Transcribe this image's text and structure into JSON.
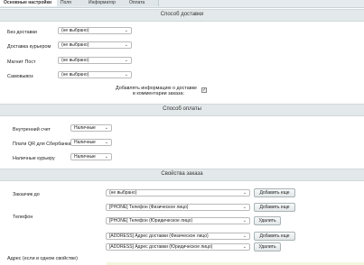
{
  "tabs": [
    "Основные настройки",
    "Поля",
    "Информатор",
    "Оплата"
  ],
  "delivery": {
    "title": "Способ доставки",
    "rows": [
      {
        "label": "Без доставки",
        "value": "(не выбрано)"
      },
      {
        "label": "Доставка курьером",
        "value": "(не выбрано)"
      },
      {
        "label": "Магнит Пост",
        "value": "(не выбрано)"
      },
      {
        "label": "Самовывоз",
        "value": "(не выбрано)"
      }
    ],
    "add_info_line1": "Добавлять информацию о доставке",
    "add_info_line2": "в комментарии заказа:",
    "add_info_checked": true
  },
  "payment": {
    "title": "Способ оплаты",
    "rows": [
      {
        "label": "Внутренний счет",
        "value": "Наличные"
      },
      {
        "label": "Плати QR для Сбербанка",
        "value": "Наличные"
      },
      {
        "label": "Наличные курьеру",
        "value": "Наличные"
      }
    ]
  },
  "props": {
    "title": "Свойства заказа",
    "fields": [
      {
        "label": "Заказчик до",
        "value": "(не выбрано)",
        "button": "Добавить еще"
      },
      {
        "value": "[PHONE] Телефон (Физическое лицо)",
        "button": "Добавить еще"
      },
      {
        "value": "[PHONE] Телефон (Юридическое лицо)",
        "button": "Удалить"
      },
      {
        "value": "[ADDRESS] Адрес доставки (Физическое лицо)",
        "button": "Добавить еще"
      },
      {
        "value": "[ADDRESS] Адрес доставки (Юридическое лицо)",
        "button": "Удалить"
      }
    ],
    "phone_label": "Телефон",
    "address_label": "Адрес (если в одном свойстве)"
  },
  "icons": {
    "select_arrow": "chevron-down-icon",
    "check": "checkbox-icon"
  }
}
